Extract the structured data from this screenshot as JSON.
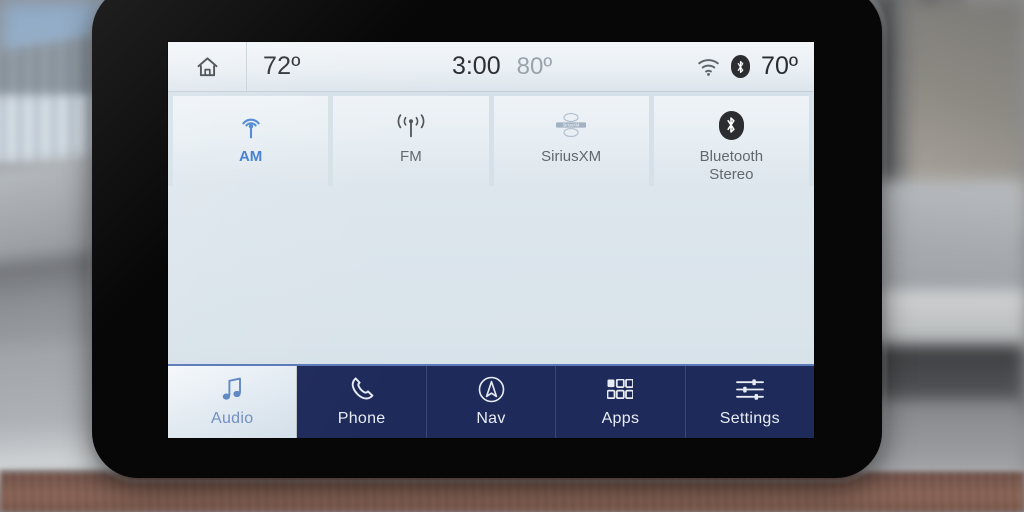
{
  "status_bar": {
    "home_icon": "home-icon",
    "cabin_temp": "72º",
    "clock": "3:00",
    "outside_temp": "80º",
    "wifi_icon": "wifi-icon",
    "bluetooth_icon": "bluetooth-icon",
    "passenger_temp": "70º"
  },
  "sources": [
    {
      "label": "AM",
      "icon": "am-antenna-icon",
      "active": true
    },
    {
      "label": "FM",
      "icon": "fm-antenna-icon",
      "active": false
    },
    {
      "label": "SiriusXM",
      "icon": "siriusxm-logo-icon",
      "active": false
    },
    {
      "label": "Bluetooth\nStereo",
      "icon": "bluetooth-icon",
      "active": false
    }
  ],
  "source_labels": {
    "am": "AM",
    "fm": "FM",
    "siriusxm": "SiriusXM",
    "bluetooth_line1": "Bluetooth",
    "bluetooth_line2": "Stereo"
  },
  "nav": {
    "audio": "Audio",
    "phone": "Phone",
    "nav": "Nav",
    "apps": "Apps",
    "settings": "Settings"
  },
  "colors": {
    "nav_bar": "#1e2a5a",
    "nav_top_border": "#5b79b8",
    "accent_blue": "#3a7bd0",
    "screen_bg": "#d9e3ea",
    "status_bg": "#eef3f7",
    "inactive_text": "#61696f",
    "bezel": "#070707"
  }
}
